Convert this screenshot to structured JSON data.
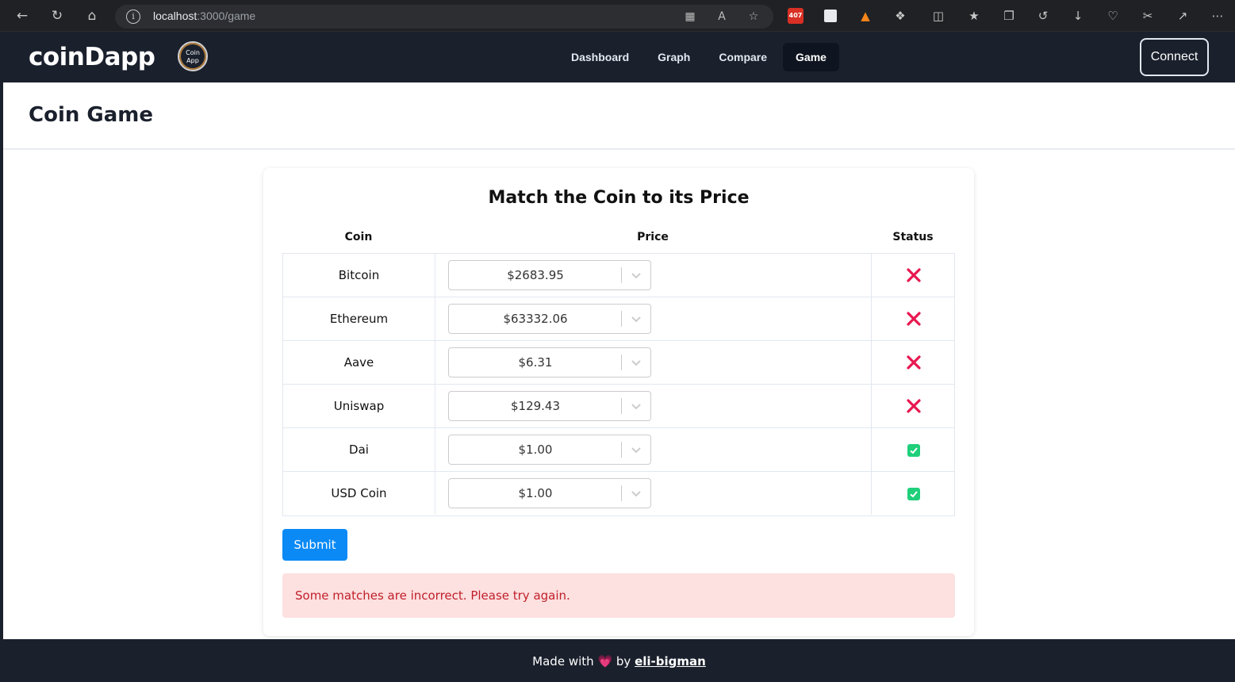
{
  "browser": {
    "url_host": "localhost",
    "url_path": ":3000/game",
    "extension_badge": "407"
  },
  "nav": {
    "brand": "coinDapp",
    "logo_text_top": "Coin",
    "logo_text_bottom": "App",
    "links": [
      "Dashboard",
      "Graph",
      "Compare",
      "Game"
    ],
    "active_link": "Game",
    "connect_label": "Connect"
  },
  "page": {
    "title": "Coin Game"
  },
  "game": {
    "heading": "Match the Coin to its Price",
    "columns": [
      "Coin",
      "Price",
      "Status"
    ],
    "rows": [
      {
        "coin": "Bitcoin",
        "price": "$2683.95",
        "status": "incorrect"
      },
      {
        "coin": "Ethereum",
        "price": "$63332.06",
        "status": "incorrect"
      },
      {
        "coin": "Aave",
        "price": "$6.31",
        "status": "incorrect"
      },
      {
        "coin": "Uniswap",
        "price": "$129.43",
        "status": "incorrect"
      },
      {
        "coin": "Dai",
        "price": "$1.00",
        "status": "correct"
      },
      {
        "coin": "USD Coin",
        "price": "$1.00",
        "status": "correct"
      }
    ],
    "submit_label": "Submit",
    "alert_message": "Some matches are incorrect. Please try again."
  },
  "footer": {
    "made_with": "Made with",
    "heart": "💗",
    "by": "by",
    "author": "eli-bigman"
  },
  "colors": {
    "nav_bg": "#1a202c",
    "submit_bg": "#0b8af5",
    "error_mark": "#e8174f",
    "correct_mark": "#1fcf7a",
    "alert_bg": "#fde0e0",
    "alert_text": "#c0202a"
  }
}
